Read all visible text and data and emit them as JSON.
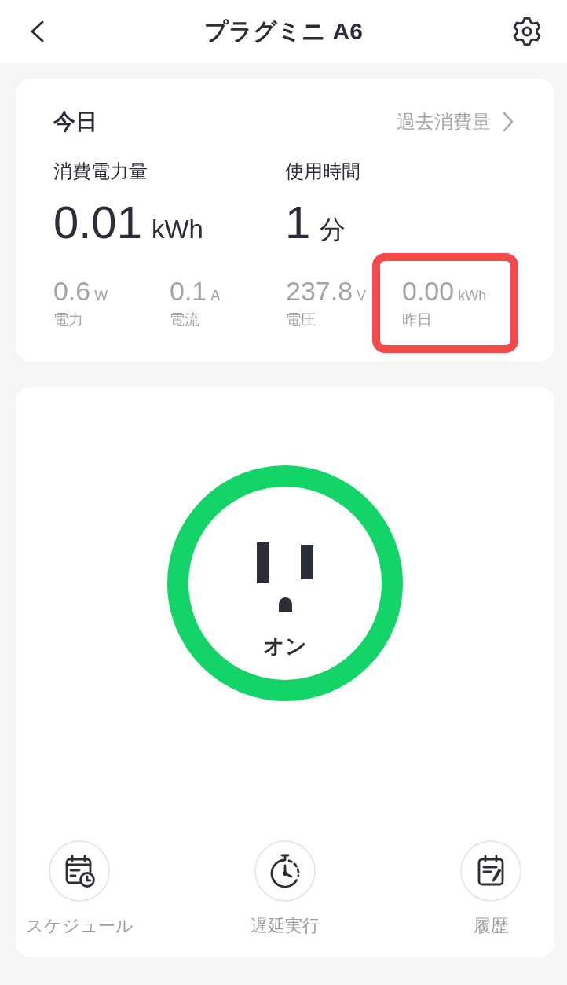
{
  "header": {
    "title": "プラグミニ A6"
  },
  "today": {
    "title": "今日",
    "history_link": "過去消費量",
    "metrics": [
      {
        "label": "消費電力量",
        "value": "0.01",
        "unit": "kWh"
      },
      {
        "label": "使用時間",
        "value": "1",
        "unit": "分"
      }
    ],
    "stats": [
      {
        "value": "0.6",
        "unit": "W",
        "label": "電力",
        "highlighted": false
      },
      {
        "value": "0.1",
        "unit": "A",
        "label": "電流",
        "highlighted": false
      },
      {
        "value": "237.8",
        "unit": "V",
        "label": "電圧",
        "highlighted": false
      },
      {
        "value": "0.00",
        "unit": "kWh",
        "label": "昨日",
        "highlighted": true
      }
    ]
  },
  "power": {
    "on": true,
    "label": "オン"
  },
  "actions": [
    {
      "kind": "schedule",
      "label": "スケジュール"
    },
    {
      "kind": "delay",
      "label": "遅延実行"
    },
    {
      "kind": "history",
      "label": "履歴"
    }
  ]
}
